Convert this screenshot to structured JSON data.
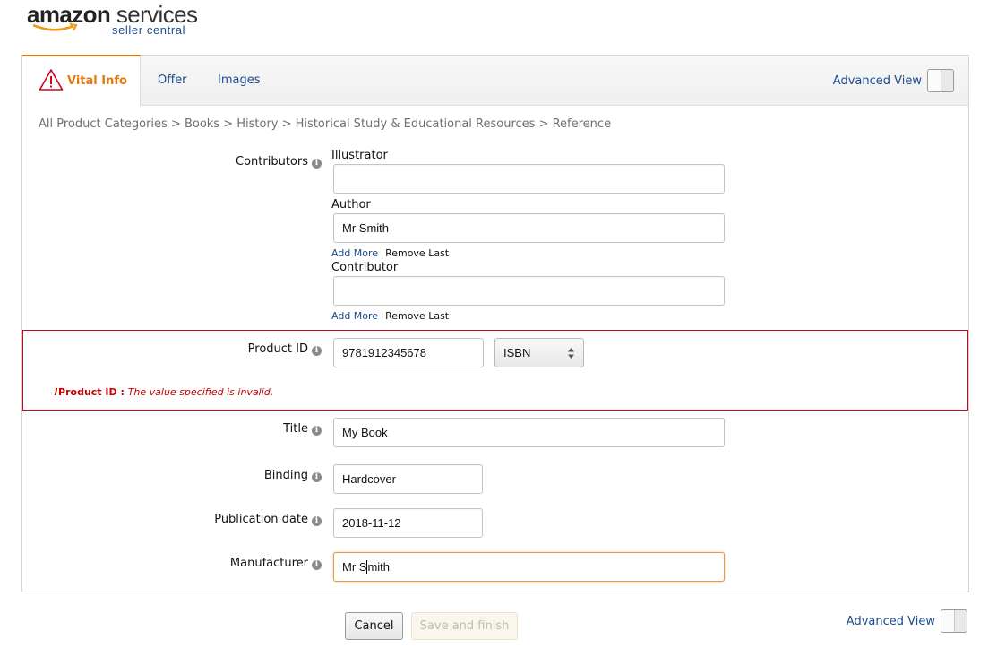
{
  "logo": {
    "brand": "amazon",
    "brand_suffix": "services",
    "subtitle": "seller central"
  },
  "tabs": [
    {
      "label": "Vital Info",
      "active": true,
      "icon": "warning-icon"
    },
    {
      "label": "Offer",
      "active": false
    },
    {
      "label": "Images",
      "active": false
    }
  ],
  "advanced_view": {
    "label": "Advanced View",
    "enabled": false
  },
  "breadcrumb": "All Product Categories > Books > History > Historical Study & Educational Resources > Reference",
  "contributors": {
    "label": "Contributors",
    "illustrator": {
      "label": "Illustrator",
      "value": ""
    },
    "author": {
      "label": "Author",
      "value": "Mr Smith"
    },
    "contributor": {
      "label": "Contributor",
      "value": ""
    },
    "add_more": "Add More",
    "remove_last": "Remove Last"
  },
  "product_id": {
    "label": "Product ID",
    "value": "9781912345678",
    "type": "ISBN",
    "error": {
      "bang": "!",
      "field": "Product ID",
      "sep": " : ",
      "message": "The value specified is invalid."
    }
  },
  "title": {
    "label": "Title",
    "value": "My Book"
  },
  "binding": {
    "label": "Binding",
    "value": "Hardcover"
  },
  "publication_date": {
    "label": "Publication date",
    "value": "2018-11-12"
  },
  "manufacturer": {
    "label": "Manufacturer",
    "value_before_caret": "Mr S",
    "value_after_caret": "mith"
  },
  "footer": {
    "cancel": "Cancel",
    "save": "Save and finish"
  },
  "colors": {
    "accent": "#e47911",
    "link": "#1a4b8f",
    "error": "#d0021b"
  }
}
